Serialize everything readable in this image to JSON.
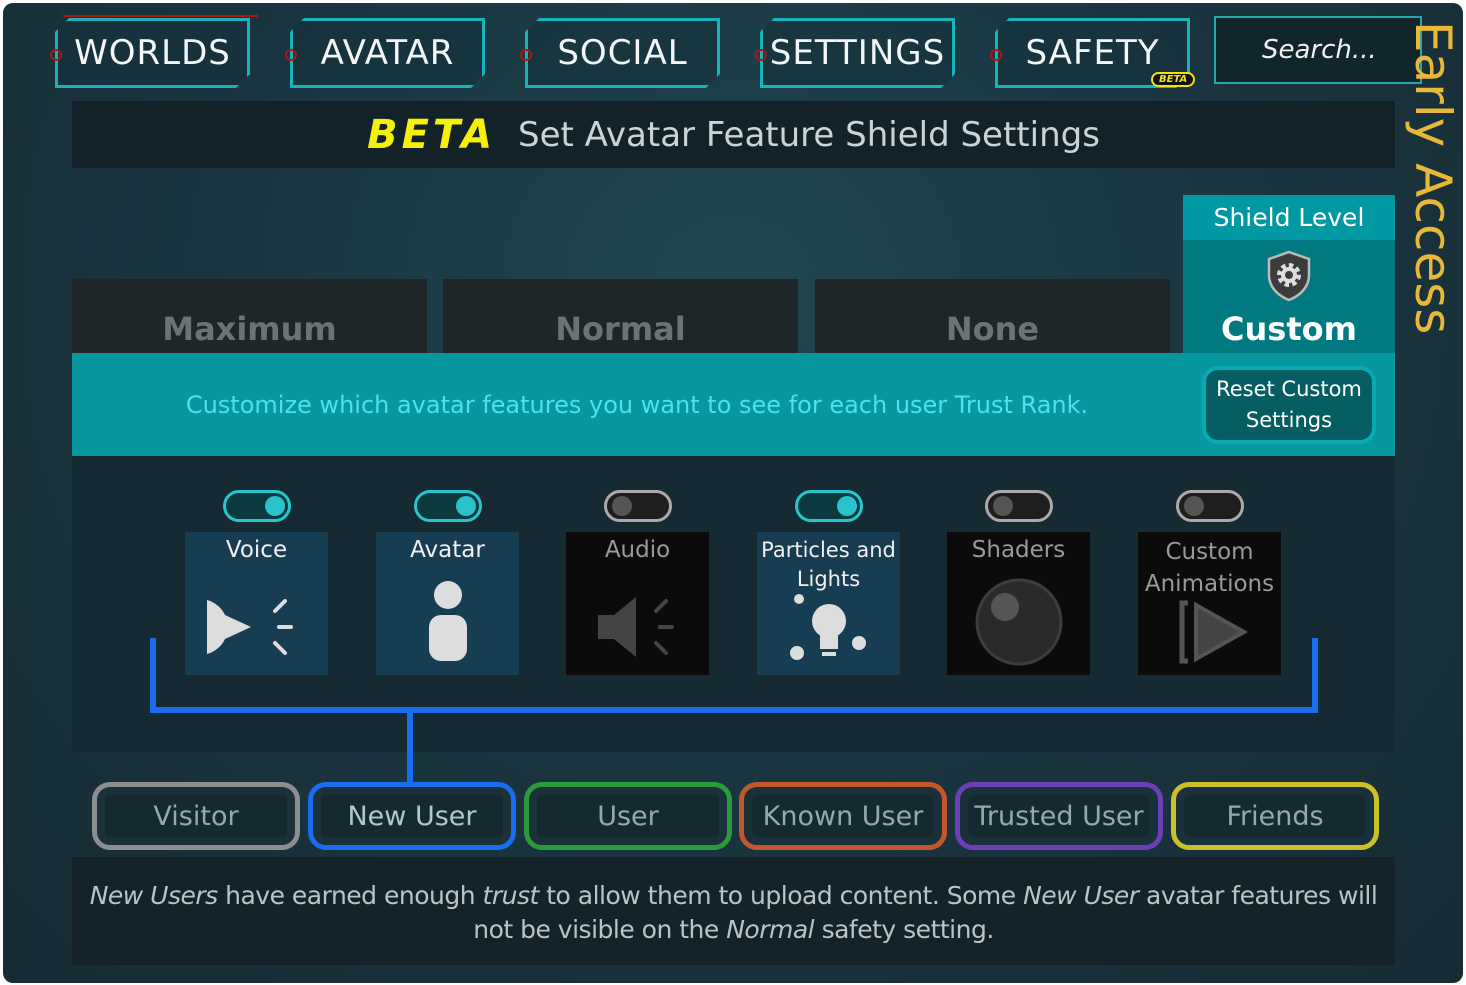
{
  "nav": {
    "tabs": [
      "WORLDS",
      "AVATAR",
      "SOCIAL",
      "SETTINGS",
      "SAFETY"
    ],
    "safety_badge": "BETA",
    "search_placeholder": "Search..."
  },
  "early_access": "Early Access",
  "title": {
    "beta": "BETA",
    "text": "Set Avatar Feature Shield Settings"
  },
  "levels": [
    "Maximum",
    "Normal",
    "None"
  ],
  "shield": {
    "header": "Shield Level",
    "current": "Custom",
    "icon": "shield-gear-icon"
  },
  "band": {
    "text": "Customize which avatar features you want to see for each user Trust Rank.",
    "reset": "Reset Custom Settings"
  },
  "features": [
    {
      "label": "Voice",
      "enabled": true,
      "icon": "voice-icon"
    },
    {
      "label": "Avatar",
      "enabled": true,
      "icon": "avatar-icon"
    },
    {
      "label": "Audio",
      "enabled": false,
      "icon": "speaker-icon"
    },
    {
      "label": "Particles and Lights",
      "enabled": true,
      "icon": "particles-lights-icon"
    },
    {
      "label": "Shaders",
      "enabled": false,
      "icon": "shader-sphere-icon"
    },
    {
      "label": "Custom Animations",
      "enabled": false,
      "icon": "animation-play-icon"
    }
  ],
  "ranks": [
    {
      "label": "Visitor",
      "color": "#8a8f91"
    },
    {
      "label": "New User",
      "color": "#1a6cf0",
      "selected": true
    },
    {
      "label": "User",
      "color": "#2a9a3c"
    },
    {
      "label": "Known User",
      "color": "#c2572e"
    },
    {
      "label": "Trusted User",
      "color": "#6a3fb8"
    },
    {
      "label": "Friends",
      "color": "#c9c02a"
    }
  ],
  "description": {
    "p1": "New Users",
    "p2": " have earned enough ",
    "p3": "trust",
    "p4": " to allow them to upload content. Some ",
    "p5": "New User",
    "p6": " avatar features will not be visible on the ",
    "p7": "Normal",
    "p8": " safety setting."
  }
}
